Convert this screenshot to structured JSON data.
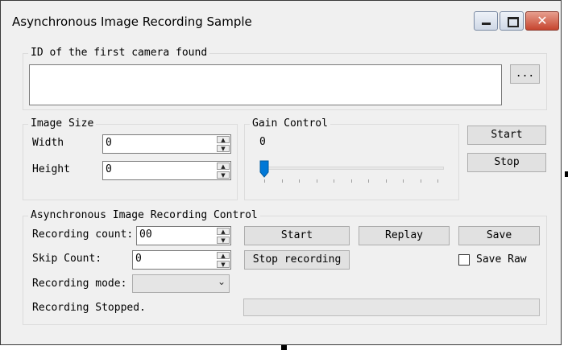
{
  "window": {
    "title": "Asynchronous Image Recording Sample",
    "controls": {
      "close_glyph": "✕"
    }
  },
  "camera": {
    "legend": "ID of the first camera found",
    "id_value": "",
    "browse_label": "..."
  },
  "image_size": {
    "legend": "Image Size",
    "width_label": "Width",
    "width_value": "0",
    "height_label": "Height",
    "height_value": "0"
  },
  "gain": {
    "legend": "Gain Control",
    "value_text": "0",
    "slider_level": 0,
    "tick_count": 11
  },
  "stream": {
    "start_label": "Start",
    "stop_label": "Stop"
  },
  "recording": {
    "legend": "Asynchronous Image Recording Control",
    "count_label": "Recording count:",
    "count_value": "00",
    "skip_label": "Skip Count:",
    "skip_value": "0",
    "mode_label": "Recording mode:",
    "mode_value": "",
    "start_label": "Start",
    "replay_label": "Replay",
    "save_label": "Save",
    "stop_label": "Stop recording",
    "save_raw_label": "Save Raw",
    "save_raw_checked": false,
    "status_text": "Recording Stopped.",
    "progress": 0
  },
  "colors": {
    "slider_accent": "#0078d7",
    "close_button": "#c6452f"
  }
}
